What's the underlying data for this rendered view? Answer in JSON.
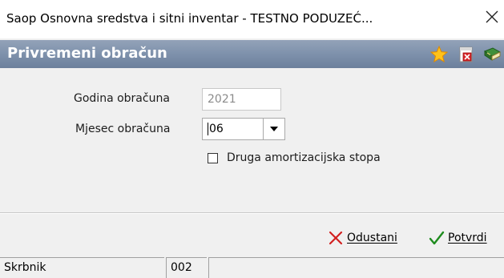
{
  "window": {
    "title": "Saop Osnovna sredstva i sitni inventar - TESTNO PODUZEĆ..."
  },
  "form": {
    "title": "Privremeni obračun",
    "header_icons": [
      "star-icon",
      "pdf-document-icon",
      "book-exit-icon"
    ]
  },
  "fields": {
    "year_label": "Godina obračuna",
    "year_value": "2021",
    "month_label": "Mjesec obračuna",
    "month_value": "06",
    "alt_rate_label": "Druga amortizacijska stopa",
    "alt_rate_checked": false
  },
  "buttons": {
    "cancel_label": "Odustani",
    "confirm_label": "Potvrdi"
  },
  "status": {
    "user": "Skrbnik",
    "code": "002",
    "info": ""
  },
  "colors": {
    "header_bar": "#7b8da8",
    "cancel_x": "#d22020",
    "confirm_check": "#1e8c1e"
  }
}
